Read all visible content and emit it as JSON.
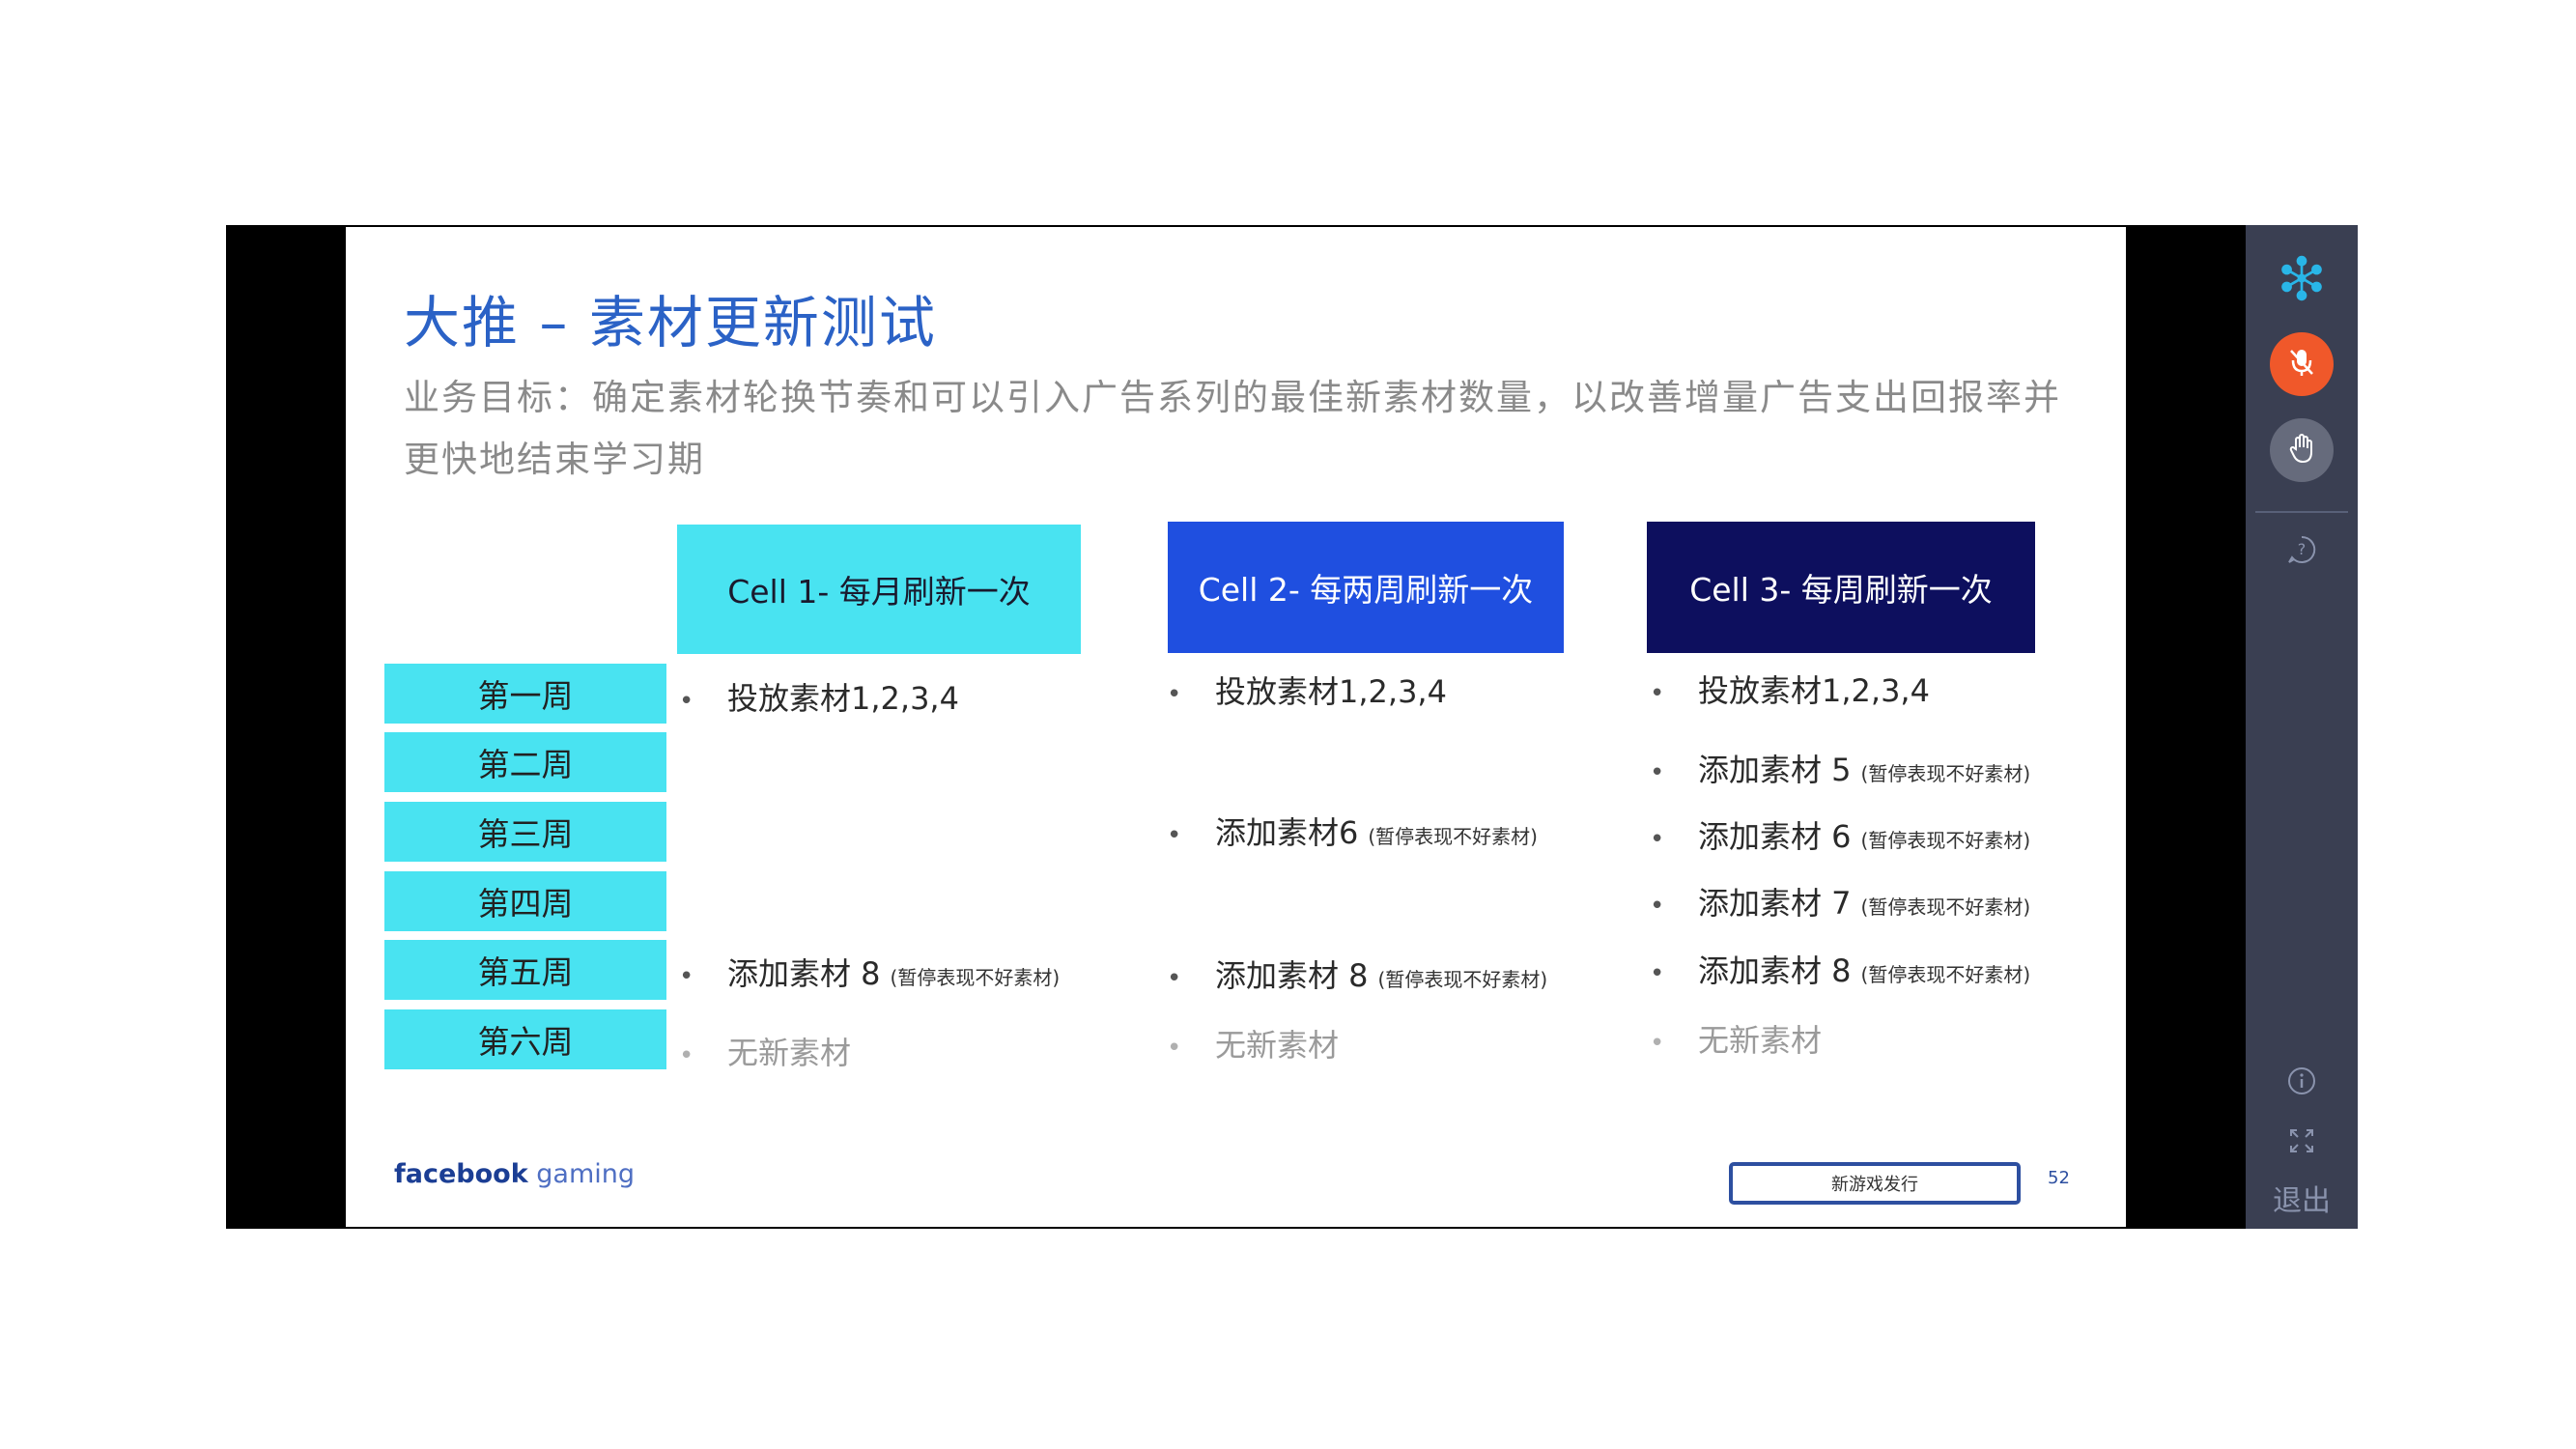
{
  "slide": {
    "title": "大推 – 素材更新测试",
    "subtitle": "业务目标：确定素材轮换节奏和可以引入广告系列的最佳新素材数量，以改善增量广告支出回报率并更快地结束学习期",
    "cells": [
      {
        "label": "Cell 1- 每月刷新一次",
        "bg": "#49e3f1",
        "fg": "#1a1a2e"
      },
      {
        "label": "Cell 2- 每两周刷新一次",
        "bg": "#1f4fe0",
        "fg": "#ffffff"
      },
      {
        "label": "Cell 3- 每周刷新一次",
        "bg": "#0d0f5e",
        "fg": "#ffffff"
      }
    ],
    "weeks": [
      "第一周",
      "第二周",
      "第三周",
      "第四周",
      "第五周",
      "第六周"
    ],
    "cell1": {
      "w1": "投放素材1,2,3,4",
      "w5": "添加素材 8",
      "w5_note": "(暂停表现不好素材)",
      "w6": "无新素材"
    },
    "cell2": {
      "w1": "投放素材1,2,3,4",
      "w3": "添加素材6",
      "w3_note": "(暂停表现不好素材)",
      "w5": "添加素材 8",
      "w5_note": "(暂停表现不好素材)",
      "w6": "无新素材"
    },
    "cell3": {
      "w1": "投放素材1,2,3,4",
      "w2": "添加素材 5",
      "w2_note": "(暂停表现不好素材)",
      "w3": "添加素材 6",
      "w3_note": "(暂停表现不好素材)",
      "w4": "添加素材 7",
      "w4_note": "(暂停表现不好素材)",
      "w5": "添加素材 8",
      "w5_note": "(暂停表现不好素材)",
      "w6": "无新素材"
    },
    "footer": {
      "brand_bold": "facebook",
      "brand_light": "gaming",
      "tag": "新游戏发行",
      "page_number": "52"
    }
  },
  "toolbar": {
    "icons": [
      "snowflake-logo-icon",
      "microphone-icon",
      "raise-hand-icon",
      "help-icon",
      "info-icon",
      "fullscreen-icon"
    ],
    "exit_label": "退出",
    "accent_mic": "#f0582a",
    "accent_logo": "#29b6e8"
  }
}
